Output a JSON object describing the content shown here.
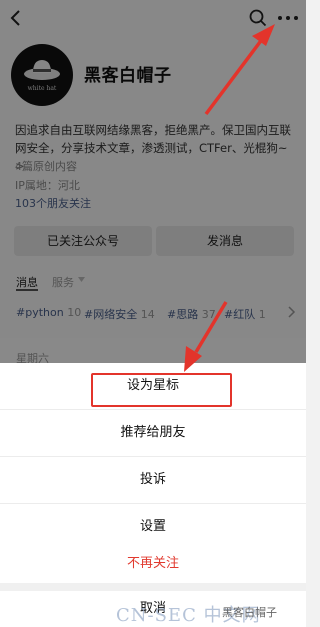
{
  "profile": {
    "name": "黑客白帽子",
    "avatar_text": "white hat",
    "description": "因追求自由互联网结缘黑客，拒绝黑产。保卫国内互联网安全，分享技术文章，渗透测试，CTFer、光棍狗~",
    "description_more": ">",
    "articles": "4篇原创内容",
    "ip": "IP属地：河北",
    "friends": "103个朋友关注"
  },
  "buttons": {
    "followed": "已关注公众号",
    "message": "发消息"
  },
  "tabs": {
    "messages": "消息",
    "services": "服务"
  },
  "tags": [
    {
      "name": "#python",
      "count": "10"
    },
    {
      "name": "#网络安全",
      "count": "14"
    },
    {
      "name": "#思路",
      "count": "37"
    },
    {
      "name": "#红队",
      "count": "1"
    }
  ],
  "feed": {
    "day": "星期六"
  },
  "sheet": {
    "star": "设为星标",
    "recommend": "推荐给朋友",
    "report": "投诉",
    "settings": "设置",
    "unfollow": "不再关注",
    "cancel": "取消"
  },
  "watermark": {
    "left": "CN-SEC 中文网",
    "right": "黑客白帽子"
  },
  "colors": {
    "highlight": "#e3342b",
    "unfollow": "#e13a2f",
    "link": "#4a5f8b"
  }
}
